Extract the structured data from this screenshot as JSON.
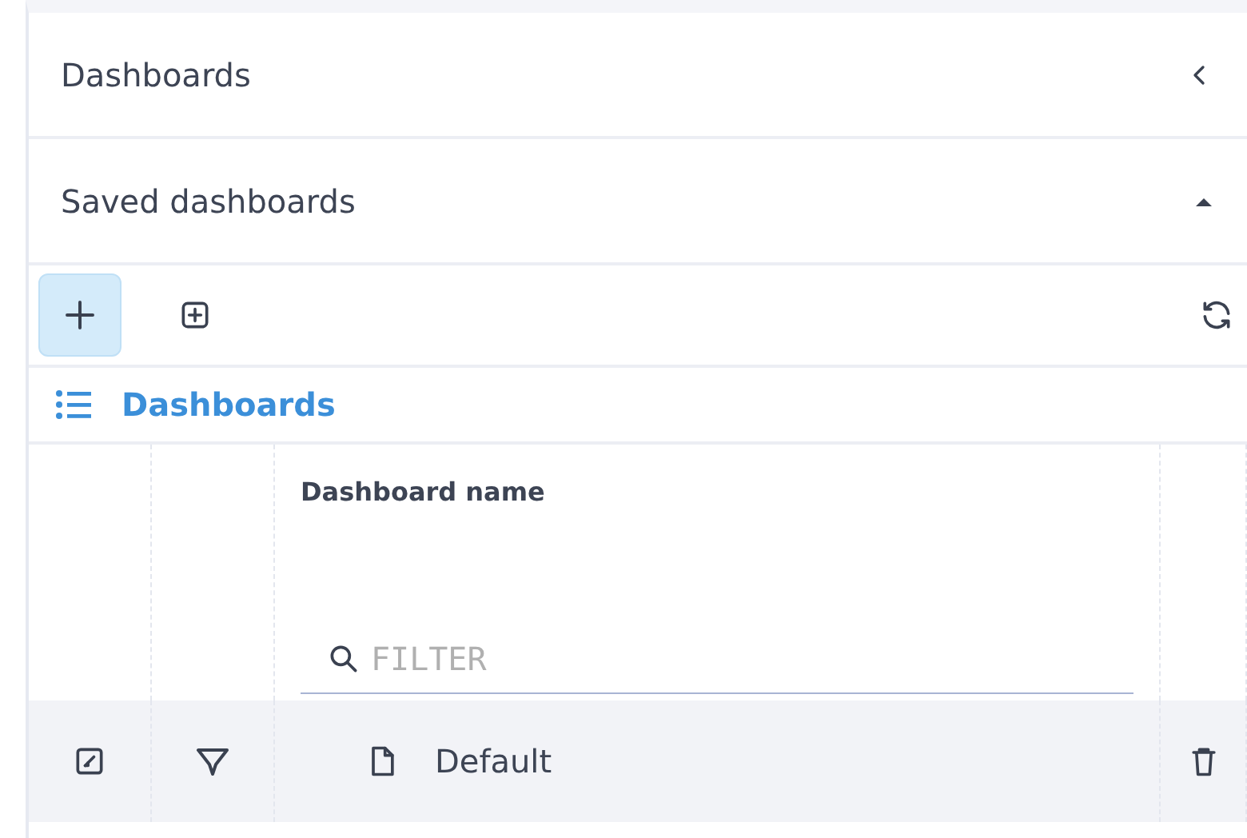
{
  "sections": [
    {
      "title": "Dashboards",
      "kind": "collapsed"
    },
    {
      "title": "Saved dashboards",
      "kind": "expanded"
    }
  ],
  "toolbar": [
    {
      "kind": "add",
      "selected": true
    },
    {
      "kind": "add-box",
      "selected": false
    }
  ],
  "list_title": "Dashboards",
  "table": {
    "columns": [
      {
        "label": "Dashboard name",
        "filter_placeholder": "FILTER"
      }
    ],
    "rows": [
      {
        "name": "Default",
        "selected": true
      }
    ]
  }
}
